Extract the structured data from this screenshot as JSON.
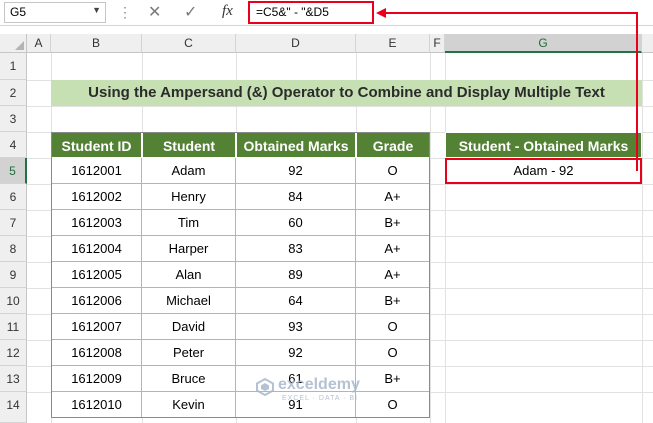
{
  "name_box": "G5",
  "formula": "=C5&\" - \"&D5",
  "columns": [
    "A",
    "B",
    "C",
    "D",
    "E",
    "F",
    "G"
  ],
  "rows": [
    "1",
    "2",
    "3",
    "4",
    "5",
    "6",
    "7",
    "8",
    "9",
    "10",
    "11",
    "12",
    "13",
    "14"
  ],
  "title": "Using the Ampersand (&) Operator to Combine and Display Multiple Text",
  "table": {
    "headers": [
      "Student ID",
      "Student",
      "Obtained Marks",
      "Grade"
    ],
    "rows": [
      [
        "1612001",
        "Adam",
        "92",
        "O"
      ],
      [
        "1612002",
        "Henry",
        "84",
        "A+"
      ],
      [
        "1612003",
        "Tim",
        "60",
        "B+"
      ],
      [
        "1612004",
        "Harper",
        "83",
        "A+"
      ],
      [
        "1612005",
        "Alan",
        "89",
        "A+"
      ],
      [
        "1612006",
        "Michael",
        "64",
        "B+"
      ],
      [
        "1612007",
        "David",
        "93",
        "O"
      ],
      [
        "1612008",
        "Peter",
        "92",
        "O"
      ],
      [
        "1612009",
        "Bruce",
        "61",
        "B+"
      ],
      [
        "1612010",
        "Kevin",
        "91",
        "O"
      ]
    ]
  },
  "result": {
    "header": "Student - Obtained Marks",
    "value": "Adam - 92"
  },
  "watermark": {
    "name": "exceldemy",
    "tagline": "EXCEL · DATA · BI"
  },
  "colors": {
    "header_green": "#548235",
    "title_green": "#c6e0b4",
    "highlight_red": "#e8001c",
    "selection_green": "#217346"
  }
}
